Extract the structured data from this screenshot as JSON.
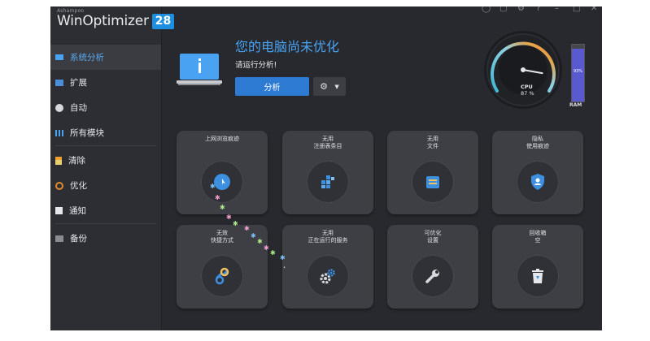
{
  "app": {
    "brand_small": "Ashampoo",
    "brand_name": "WinOptimizer",
    "brand_version": "28"
  },
  "sidebar": {
    "items": [
      {
        "label": "系统分析",
        "icon": "system-analysis-icon",
        "active": true
      },
      {
        "label": "扩展",
        "icon": "extend-icon"
      },
      {
        "label": "自动",
        "icon": "auto-icon"
      },
      {
        "label": "所有模块",
        "icon": "modules-grid-icon"
      },
      {
        "label": "清除",
        "icon": "broom-icon"
      },
      {
        "label": "优化",
        "icon": "speedometer-icon"
      },
      {
        "label": "通知",
        "icon": "check-box-icon"
      },
      {
        "label": "备份",
        "icon": "backup-icon"
      }
    ]
  },
  "header": {
    "title": "您的电脑尚未优化",
    "subtitle": "请运行分析!",
    "analyze_button": "分析"
  },
  "gauge": {
    "cpu_label": "CPU",
    "cpu_value": "87 %",
    "cpu_percent": 87,
    "ram_label": "RAM",
    "ram_value": "93%",
    "ram_percent": 93
  },
  "tiles": [
    {
      "label": "上网浏览痕迹",
      "icon": "browser-globe-icon"
    },
    {
      "label": "无用\n注册表条目",
      "icon": "registry-blocks-icon"
    },
    {
      "label": "无用\n文件",
      "icon": "files-tray-icon"
    },
    {
      "label": "隐私\n使用痕迹",
      "icon": "privacy-shield-icon"
    },
    {
      "label": "无效\n快捷方式",
      "icon": "broken-link-icon"
    },
    {
      "label": "无用\n正在运行的服务",
      "icon": "services-gears-icon"
    },
    {
      "label": "可优化\n设置",
      "icon": "wrench-icon"
    },
    {
      "label": "回收箱\n空",
      "icon": "recycle-bin-icon"
    }
  ],
  "colors": {
    "accent": "#4aa3f2",
    "button": "#2e7bd4",
    "badge": "#1d8fe1",
    "ram": "#5a5ad0"
  }
}
